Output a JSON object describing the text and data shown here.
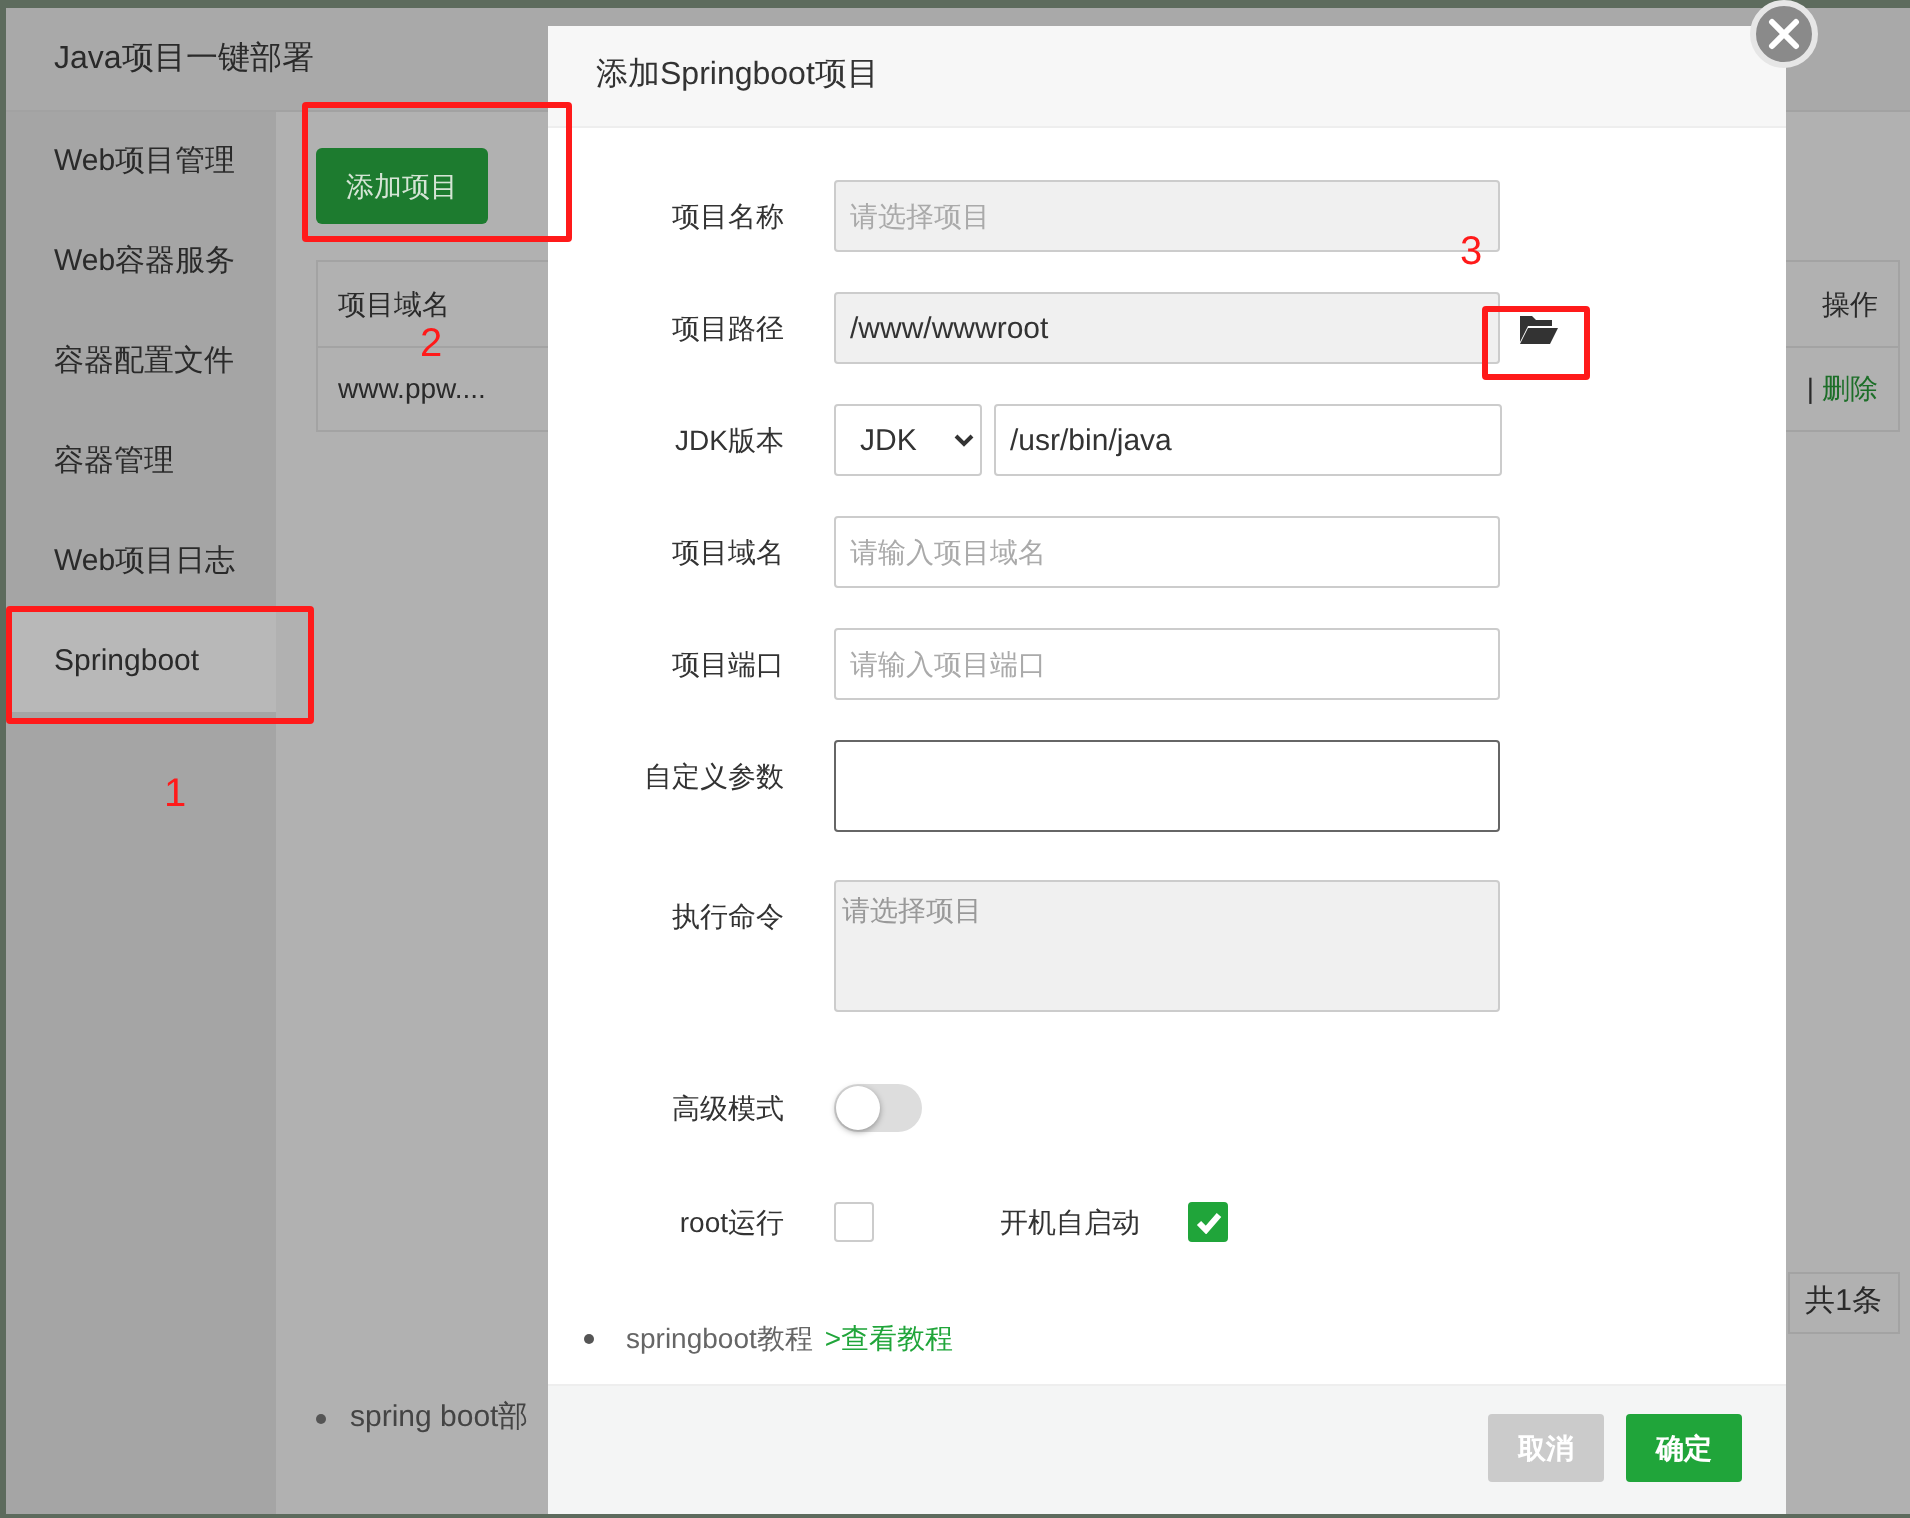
{
  "app": {
    "title": "Java项目一键部署",
    "sidebar": [
      {
        "label": "Web项目管理",
        "selected": false
      },
      {
        "label": "Web容器服务",
        "selected": false
      },
      {
        "label": "容器配置文件",
        "selected": false
      },
      {
        "label": "容器管理",
        "selected": false
      },
      {
        "label": "Web项目日志",
        "selected": false
      },
      {
        "label": "Springboot",
        "selected": true
      }
    ],
    "add_button": "添加项目",
    "table": {
      "columns": [
        "项目域名",
        "操作"
      ],
      "rows": [
        {
          "domain": "www.ppw....",
          "separator": "|",
          "actions": [
            "删除"
          ]
        }
      ]
    },
    "pagination": "共1条",
    "footer_note": "spring boot部"
  },
  "dialog": {
    "title": "添加Springboot项目",
    "fields": [
      {
        "kind": "input",
        "label": "项目名称",
        "placeholder": "请选择项目",
        "readonly": true
      },
      {
        "kind": "path",
        "label": "项目路径",
        "value": "/www/wwwroot",
        "readonly": true
      },
      {
        "kind": "jdk",
        "label": "JDK版本",
        "select": "JDK",
        "value": "/usr/bin/java"
      },
      {
        "kind": "input",
        "label": "项目域名",
        "placeholder": "请输入项目域名",
        "readonly": false
      },
      {
        "kind": "input",
        "label": "项目端口",
        "placeholder": "请输入项目端口",
        "readonly": false
      },
      {
        "kind": "textarea",
        "label": "自定义参数",
        "focused": true,
        "readonly": false
      },
      {
        "kind": "textarea",
        "label": "执行命令",
        "placeholder": "请选择项目",
        "readonly": true
      },
      {
        "kind": "toggle",
        "label": "高级模式",
        "on": false
      },
      {
        "kind": "checks",
        "items": [
          {
            "label": "root运行",
            "checked": false
          },
          {
            "label": "开机自启动",
            "checked": true
          }
        ]
      }
    ],
    "tutorial": {
      "text": "springboot教程",
      "link": ">查看教程"
    },
    "buttons": [
      {
        "label": "取消",
        "kind": "cancel"
      },
      {
        "label": "确定",
        "kind": "primary"
      }
    ]
  },
  "annotations": [
    {
      "label": "1"
    },
    {
      "label": "2"
    },
    {
      "label": "3"
    }
  ]
}
